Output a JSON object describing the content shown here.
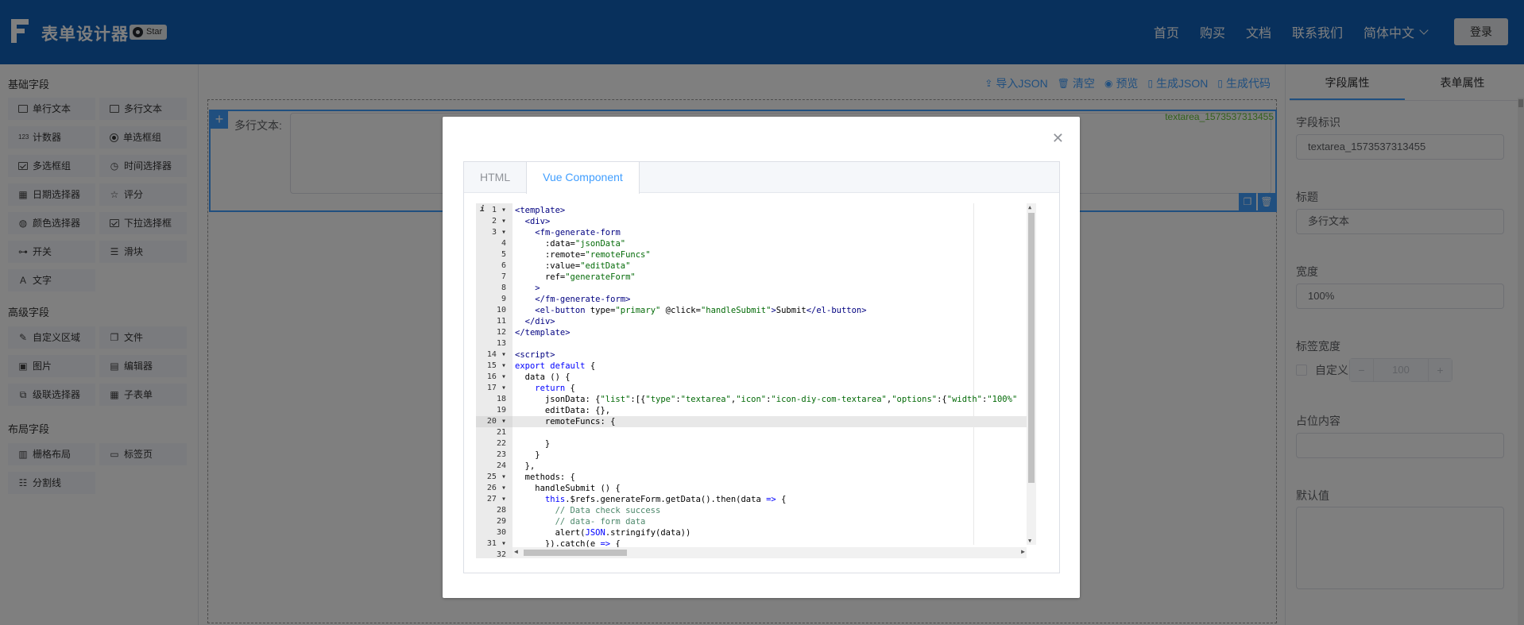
{
  "header": {
    "app_title": "表单设计器",
    "star_label": "Star",
    "nav": [
      "首页",
      "购买",
      "文档",
      "联系我们"
    ],
    "language": "简体中文",
    "login": "登录"
  },
  "left": {
    "basic_title": "基础字段",
    "basic_fields": [
      {
        "label": "单行文本",
        "icon": "input-icon"
      },
      {
        "label": "多行文本",
        "icon": "textarea-icon"
      },
      {
        "label": "计数器",
        "icon": "number-icon"
      },
      {
        "label": "单选框组",
        "icon": "radio-icon"
      },
      {
        "label": "多选框组",
        "icon": "checkbox-icon"
      },
      {
        "label": "时间选择器",
        "icon": "clock-icon"
      },
      {
        "label": "日期选择器",
        "icon": "calendar-icon"
      },
      {
        "label": "评分",
        "icon": "star-icon"
      },
      {
        "label": "颜色选择器",
        "icon": "palette-icon"
      },
      {
        "label": "下拉选择框",
        "icon": "select-icon"
      },
      {
        "label": "开关",
        "icon": "switch-icon"
      },
      {
        "label": "滑块",
        "icon": "slider-icon"
      },
      {
        "label": "文字",
        "icon": "text-icon"
      }
    ],
    "advanced_title": "高级字段",
    "advanced_fields": [
      {
        "label": "自定义区域",
        "icon": "pen-icon"
      },
      {
        "label": "文件",
        "icon": "file-icon"
      },
      {
        "label": "图片",
        "icon": "image-icon"
      },
      {
        "label": "编辑器",
        "icon": "editor-icon"
      },
      {
        "label": "级联选择器",
        "icon": "cascader-icon"
      },
      {
        "label": "子表单",
        "icon": "table-icon"
      }
    ],
    "layout_title": "布局字段",
    "layout_fields": [
      {
        "label": "栅格布局",
        "icon": "grid-icon"
      },
      {
        "label": "标签页",
        "icon": "tabs-icon"
      },
      {
        "label": "分割线",
        "icon": "divider-icon"
      }
    ]
  },
  "toolbar": {
    "import_json": "导入JSON",
    "clear": "清空",
    "preview": "预览",
    "gen_json": "生成JSON",
    "gen_code": "生成代码"
  },
  "canvas": {
    "item_label": "多行文本:",
    "item_model": "textarea_1573537313455"
  },
  "right": {
    "tab_field": "字段属性",
    "tab_form": "表单属性",
    "field_id_label": "字段标识",
    "field_id_value": "textarea_1573537313455",
    "title_label": "标题",
    "title_value": "多行文本",
    "width_label": "宽度",
    "width_value": "100%",
    "label_width_label": "标签宽度",
    "custom_label": "自定义",
    "label_width_value": "100",
    "placeholder_label": "占位内容",
    "placeholder_value": "",
    "default_label": "默认值"
  },
  "dialog": {
    "tabs": [
      "HTML",
      "Vue Component"
    ],
    "active_tab": "Vue Component",
    "active_line": 20,
    "code": [
      {
        "n": 1,
        "fold": true,
        "tokens": [
          [
            "tag",
            "<template>"
          ]
        ]
      },
      {
        "n": 2,
        "fold": true,
        "tokens": [
          [
            "plain",
            "  "
          ],
          [
            "tag",
            "<div>"
          ]
        ]
      },
      {
        "n": 3,
        "fold": true,
        "tokens": [
          [
            "plain",
            "    "
          ],
          [
            "tag",
            "<fm-generate-form"
          ]
        ]
      },
      {
        "n": 4,
        "fold": false,
        "tokens": [
          [
            "plain",
            "      "
          ],
          [
            "attr",
            ":data="
          ],
          [
            "str",
            "\"jsonData\""
          ]
        ]
      },
      {
        "n": 5,
        "fold": false,
        "tokens": [
          [
            "plain",
            "      "
          ],
          [
            "attr",
            ":remote="
          ],
          [
            "str",
            "\"remoteFuncs\""
          ]
        ]
      },
      {
        "n": 6,
        "fold": false,
        "tokens": [
          [
            "plain",
            "      "
          ],
          [
            "attr",
            ":value="
          ],
          [
            "str",
            "\"editData\""
          ]
        ]
      },
      {
        "n": 7,
        "fold": false,
        "tokens": [
          [
            "plain",
            "      "
          ],
          [
            "attr",
            "ref="
          ],
          [
            "str",
            "\"generateForm\""
          ]
        ]
      },
      {
        "n": 8,
        "fold": false,
        "tokens": [
          [
            "plain",
            "    "
          ],
          [
            "tag",
            ">"
          ]
        ]
      },
      {
        "n": 9,
        "fold": false,
        "tokens": [
          [
            "plain",
            "    "
          ],
          [
            "tag",
            "</fm-generate-form>"
          ]
        ]
      },
      {
        "n": 10,
        "fold": false,
        "tokens": [
          [
            "plain",
            "    "
          ],
          [
            "tag",
            "<el-button"
          ],
          [
            "attr",
            " type="
          ],
          [
            "str",
            "\"primary\""
          ],
          [
            "attr",
            " @click="
          ],
          [
            "str",
            "\"handleSubmit\""
          ],
          [
            "tag",
            ">"
          ],
          [
            "plain",
            "Submit"
          ],
          [
            "tag",
            "</el-button>"
          ]
        ]
      },
      {
        "n": 11,
        "fold": false,
        "tokens": [
          [
            "plain",
            "  "
          ],
          [
            "tag",
            "</div>"
          ]
        ]
      },
      {
        "n": 12,
        "fold": false,
        "tokens": [
          [
            "tag",
            "</template>"
          ]
        ]
      },
      {
        "n": 13,
        "fold": false,
        "tokens": [
          [
            "plain",
            ""
          ]
        ]
      },
      {
        "n": 14,
        "fold": true,
        "tokens": [
          [
            "tag",
            "<script>"
          ]
        ]
      },
      {
        "n": 15,
        "fold": true,
        "tokens": [
          [
            "kw",
            "export default"
          ],
          [
            "plain",
            " {"
          ]
        ]
      },
      {
        "n": 16,
        "fold": true,
        "tokens": [
          [
            "plain",
            "  data () {"
          ]
        ]
      },
      {
        "n": 17,
        "fold": true,
        "tokens": [
          [
            "plain",
            "    "
          ],
          [
            "kw",
            "return"
          ],
          [
            "plain",
            " {"
          ]
        ]
      },
      {
        "n": 18,
        "fold": false,
        "tokens": [
          [
            "plain",
            "      jsonData: {"
          ],
          [
            "str",
            "\"list\""
          ],
          [
            "plain",
            ":[{"
          ],
          [
            "str",
            "\"type\""
          ],
          [
            "plain",
            ":"
          ],
          [
            "str",
            "\"textarea\""
          ],
          [
            "plain",
            ","
          ],
          [
            "str",
            "\"icon\""
          ],
          [
            "plain",
            ":"
          ],
          [
            "str",
            "\"icon-diy-com-textarea\""
          ],
          [
            "plain",
            ","
          ],
          [
            "str",
            "\"options\""
          ],
          [
            "plain",
            ":{"
          ],
          [
            "str",
            "\"width\""
          ],
          [
            "plain",
            ":"
          ],
          [
            "str",
            "\"100%\""
          ]
        ]
      },
      {
        "n": 19,
        "fold": false,
        "tokens": [
          [
            "plain",
            "      editData: {},"
          ]
        ]
      },
      {
        "n": 20,
        "fold": true,
        "tokens": [
          [
            "plain",
            "      remoteFuncs: {"
          ]
        ]
      },
      {
        "n": 21,
        "fold": false,
        "tokens": [
          [
            "plain",
            ""
          ]
        ]
      },
      {
        "n": 22,
        "fold": false,
        "tokens": [
          [
            "plain",
            "      }"
          ]
        ]
      },
      {
        "n": 23,
        "fold": false,
        "tokens": [
          [
            "plain",
            "    }"
          ]
        ]
      },
      {
        "n": 24,
        "fold": false,
        "tokens": [
          [
            "plain",
            "  },"
          ]
        ]
      },
      {
        "n": 25,
        "fold": true,
        "tokens": [
          [
            "plain",
            "  methods: {"
          ]
        ]
      },
      {
        "n": 26,
        "fold": true,
        "tokens": [
          [
            "plain",
            "    handleSubmit () {"
          ]
        ]
      },
      {
        "n": 27,
        "fold": true,
        "tokens": [
          [
            "plain",
            "      "
          ],
          [
            "kw",
            "this"
          ],
          [
            "plain",
            ".$refs.generateForm.getData().then(data "
          ],
          [
            "kw",
            "=>"
          ],
          [
            "plain",
            " {"
          ]
        ]
      },
      {
        "n": 28,
        "fold": false,
        "tokens": [
          [
            "plain",
            "        "
          ],
          [
            "cmt",
            "// Data check success"
          ]
        ]
      },
      {
        "n": 29,
        "fold": false,
        "tokens": [
          [
            "plain",
            "        "
          ],
          [
            "cmt",
            "// data- form data"
          ]
        ]
      },
      {
        "n": 30,
        "fold": false,
        "tokens": [
          [
            "plain",
            "        alert("
          ],
          [
            "kw",
            "JSON"
          ],
          [
            "plain",
            ".stringify(data))"
          ]
        ]
      },
      {
        "n": 31,
        "fold": true,
        "tokens": [
          [
            "plain",
            "      }).catch(e "
          ],
          [
            "kw",
            "=>"
          ],
          [
            "plain",
            " {"
          ]
        ]
      },
      {
        "n": 32,
        "fold": false,
        "tokens": [
          [
            "plain",
            ""
          ]
        ]
      }
    ]
  }
}
